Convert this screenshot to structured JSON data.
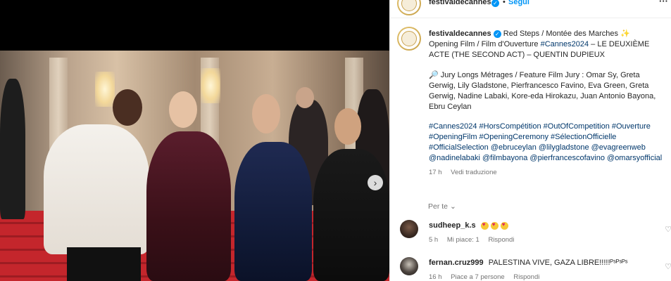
{
  "header": {
    "username": "festivaldecannes",
    "follow_label": "Segui",
    "more_label": "···"
  },
  "photo": {
    "next_arrow": "›"
  },
  "caption": {
    "username": "festivaldecannes",
    "line1_text": "Red Steps / Montée des Marches ✨",
    "line2_pre": "Opening Film / Film d'Ouverture ",
    "line2_tag": "#Cannes2024",
    "line2_post": " – LE DEUXIÈME ACTE (THE SECOND ACT) – QUENTIN DUPIEUX",
    "jury_text": "🔎 Jury Longs Métrages / Feature Film Jury : Omar Sy, Greta Gerwig, Lily Gladstone, Pierfrancesco Favino, Eva Green, Greta Gerwig, Nadine Labaki, Kore-eda Hirokazu, Juan Antonio Bayona, Ebru Ceylan",
    "hashtags": "#Cannes2024 #HorsCompétition #OutOfCompetition #Ouverture #OpeningFilm #OpeningCeremony #SélectionOfficielle #OfficialSelection @ebruceylan @lilygladstone @evagreenweb @nadinelabaki @filmbayona @pierfrancescofavino @omarsyofficial",
    "time": "17 h",
    "translate_label": "Vedi traduzione"
  },
  "comments_section": {
    "per_te_label": "Per te",
    "comments": [
      {
        "username": "sudheep_k.s",
        "text": "😍😍😍",
        "time": "5 h",
        "likes": "Mi piace: 1",
        "reply_label": "Rispondi"
      },
      {
        "username": "fernan.cruz999",
        "text": "PALESTINA VIVE, GAZA LIBRE!!!!!ᴾˢᴾˢᴾˢ",
        "time": "16 h",
        "likes": "Piace a 7 persone",
        "reply_label": "Rispondi"
      }
    ]
  },
  "colors": {
    "verified": "#0095f6",
    "follow": "#0095f6",
    "link": "#00376b",
    "meta": "#737373"
  },
  "icons": [
    "verified-badge-icon",
    "more-icon",
    "next-arrow-icon",
    "chevron-down-icon",
    "heart-icon"
  ]
}
